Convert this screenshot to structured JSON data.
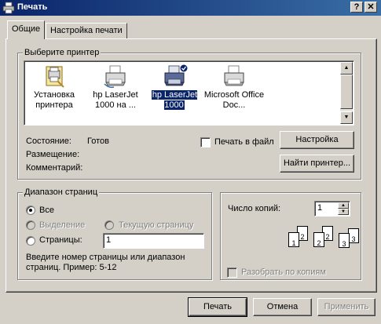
{
  "window": {
    "title": "Печать",
    "help_button": "?",
    "close_button": "✕"
  },
  "tabs": [
    {
      "label": "Общие",
      "active": true
    },
    {
      "label": "Настройка печати",
      "active": false
    }
  ],
  "printer_group": {
    "legend": "Выберите принтер",
    "printers": [
      {
        "label": "Установка принтера",
        "icon": "add-printer-icon",
        "selected": false
      },
      {
        "label": "hp LaserJet 1000 на ...",
        "icon": "printer-icon",
        "selected": false
      },
      {
        "label": "hp LaserJet 1000",
        "icon": "default-printer-icon",
        "selected": true
      },
      {
        "label": "Microsoft Office Doc...",
        "icon": "printer-icon",
        "selected": false
      }
    ],
    "status_label": "Состояние:",
    "status_value": "Готов",
    "location_label": "Размещение:",
    "comment_label": "Комментарий:",
    "print_to_file_label": "Печать в файл",
    "print_to_file_checked": false,
    "settings_button": "Настройка",
    "find_printer_button": "Найти принтер..."
  },
  "page_range": {
    "legend": "Диапазон страниц",
    "all_label": "Все",
    "all_selected": true,
    "selection_label": "Выделение",
    "current_page_label": "Текущую страницу",
    "pages_label": "Страницы:",
    "pages_value": "1",
    "hint": "Введите номер страницы или диапазон страниц.  Пример: 5-12"
  },
  "copies": {
    "label": "Число копий:",
    "value": "1",
    "collate_label": "Разобрать по копиям",
    "collate_checked": false,
    "collate_pages": [
      "1",
      "2",
      "3",
      "1",
      "2",
      "3"
    ]
  },
  "footer": {
    "print_button": "Печать",
    "cancel_button": "Отмена",
    "apply_button": "Применить"
  },
  "colors": {
    "titlebar": "#0a246a",
    "face": "#d4d0c8",
    "selection": "#0a246a"
  }
}
